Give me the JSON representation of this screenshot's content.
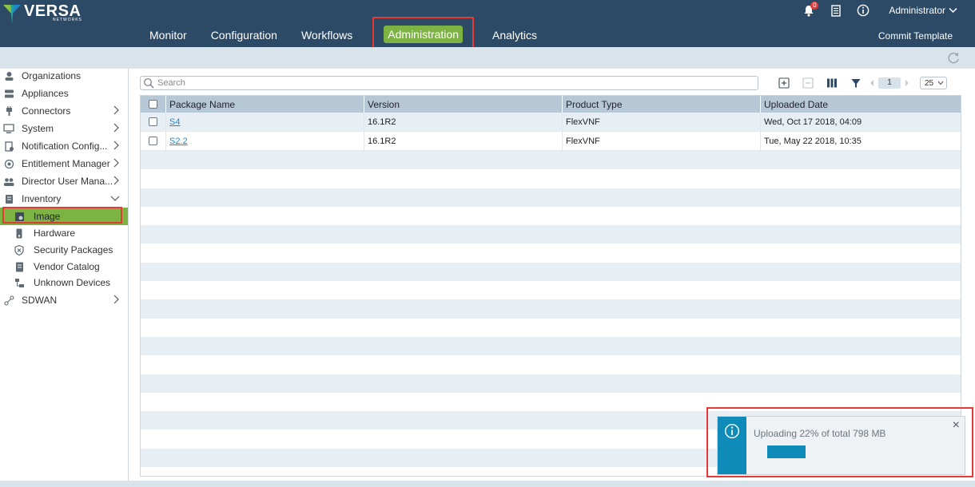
{
  "header": {
    "logo_text": "VERSA",
    "logo_subtext": "NETWORKS",
    "notification_count": "0",
    "user_label": "Administrator",
    "commit_label": "Commit Template",
    "nav": [
      {
        "label": "Monitor"
      },
      {
        "label": "Configuration"
      },
      {
        "label": "Workflows"
      },
      {
        "label": "Administration",
        "active": true
      },
      {
        "label": "Analytics"
      }
    ]
  },
  "sidebar": {
    "items": [
      {
        "label": "Organizations",
        "icon": "organizations-icon"
      },
      {
        "label": "Appliances",
        "icon": "appliances-icon"
      },
      {
        "label": "Connectors",
        "icon": "connectors-icon",
        "expandable": true
      },
      {
        "label": "System",
        "icon": "system-icon",
        "expandable": true
      },
      {
        "label": "Notification Config...",
        "icon": "notification-config-icon",
        "expandable": true
      },
      {
        "label": "Entitlement Manager",
        "icon": "entitlement-icon",
        "expandable": true
      },
      {
        "label": "Director User Mana...",
        "icon": "users-icon",
        "expandable": true
      },
      {
        "label": "Inventory",
        "icon": "inventory-icon",
        "expanded": true
      },
      {
        "label": "Image",
        "icon": "image-icon",
        "sub": true,
        "selected": true
      },
      {
        "label": "Hardware",
        "icon": "hardware-icon",
        "sub": true
      },
      {
        "label": "Security Packages",
        "icon": "security-packages-icon",
        "sub": true
      },
      {
        "label": "Vendor Catalog",
        "icon": "vendor-catalog-icon",
        "sub": true
      },
      {
        "label": "Unknown Devices",
        "icon": "unknown-devices-icon",
        "sub": true
      },
      {
        "label": "SDWAN",
        "icon": "sdwan-icon",
        "expandable": true
      }
    ]
  },
  "search": {
    "placeholder": "Search"
  },
  "pagination": {
    "page": "1",
    "per_page": "25"
  },
  "table": {
    "columns": [
      "Package Name",
      "Version",
      "Product Type",
      "Uploaded Date"
    ],
    "rows": [
      {
        "name": "S4",
        "version": "16.1R2",
        "type": "FlexVNF",
        "date": "Wed, Oct 17 2018, 04:09"
      },
      {
        "name": "S2.2",
        "version": "16.1R2",
        "type": "FlexVNF",
        "date": "Tue, May 22 2018, 10:35"
      }
    ]
  },
  "notification": {
    "message": "Uploading 22% of total 798 MB",
    "close_label": "×",
    "progress_percent": 22
  },
  "colors": {
    "header_bg": "#2c4a66",
    "accent_green": "#7cb342",
    "highlight_red": "#e53935",
    "info_blue": "#0e8bb8"
  }
}
